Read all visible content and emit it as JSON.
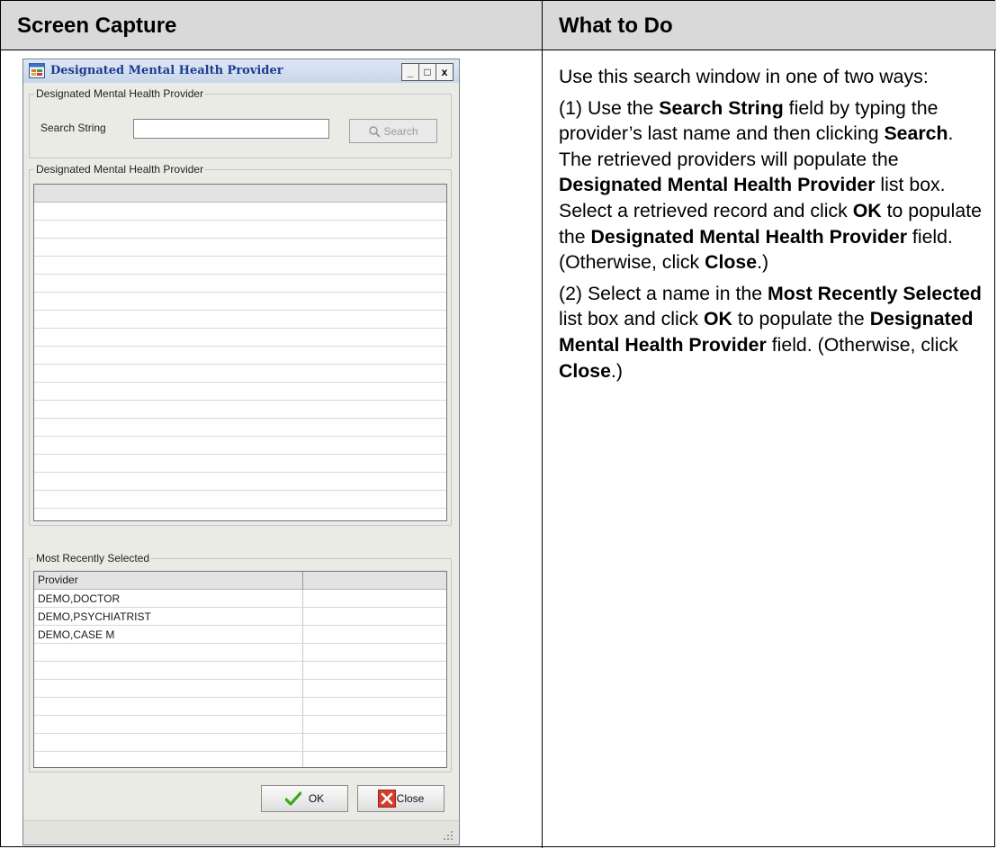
{
  "table": {
    "left_header": "Screen Capture",
    "right_header": "What to Do"
  },
  "instructions": {
    "p1": "Use this search window in one of two ways:",
    "p2": [
      {
        "t": "(1) Use the ",
        "b": false
      },
      {
        "t": "Search String",
        "b": true
      },
      {
        "t": " field by typing the provider’s last name and then clicking ",
        "b": false
      },
      {
        "t": "Search",
        "b": true
      },
      {
        "t": ". The retrieved providers will populate the ",
        "b": false
      },
      {
        "t": "Designated Mental Health Provider",
        "b": true
      },
      {
        "t": " list box. Select a retrieved record and click ",
        "b": false
      },
      {
        "t": "OK",
        "b": true
      },
      {
        "t": " to populate the ",
        "b": false
      },
      {
        "t": "Designated Mental Health Provider",
        "b": true
      },
      {
        "t": " field. (Otherwise, click ",
        "b": false
      },
      {
        "t": "Close",
        "b": true
      },
      {
        "t": ".)",
        "b": false
      }
    ],
    "p3": [
      {
        "t": "(2) Select a name in the ",
        "b": false
      },
      {
        "t": "Most Recently Selected",
        "b": true
      },
      {
        "t": " list box and click ",
        "b": false
      },
      {
        "t": "OK",
        "b": true
      },
      {
        "t": " to populate the ",
        "b": false
      },
      {
        "t": "Designated Mental Health Provider",
        "b": true
      },
      {
        "t": " field. (Otherwise, click ",
        "b": false
      },
      {
        "t": "Close",
        "b": true
      },
      {
        "t": ".)",
        "b": false
      }
    ]
  },
  "dialog": {
    "title": "Designated Mental Health Provider",
    "window_buttons": [
      "_",
      "□",
      "x"
    ],
    "search_group_label": "Designated Mental Health Provider",
    "search_label": "Search String",
    "search_value": "",
    "search_button": "Search",
    "results_group_label": "Designated Mental Health Provider",
    "recent_group_label": "Most Recently Selected",
    "recent_column": "Provider",
    "recent_items": [
      "DEMO,DOCTOR",
      "DEMO,PSYCHIATRIST",
      "DEMO,CASE M"
    ],
    "ok_button": "OK",
    "close_button": "Close"
  },
  "icons": {
    "app": "app-window-icon",
    "search": "magnifier-icon",
    "ok": "green-checkmark-icon",
    "close": "red-x-icon",
    "grip": "resize-grip-icon"
  },
  "colors": {
    "title_text": "#1b3d8f",
    "ok_check": "#3caa1e",
    "close_x": "#d93b2b",
    "table_header": "#d9d9d9"
  }
}
